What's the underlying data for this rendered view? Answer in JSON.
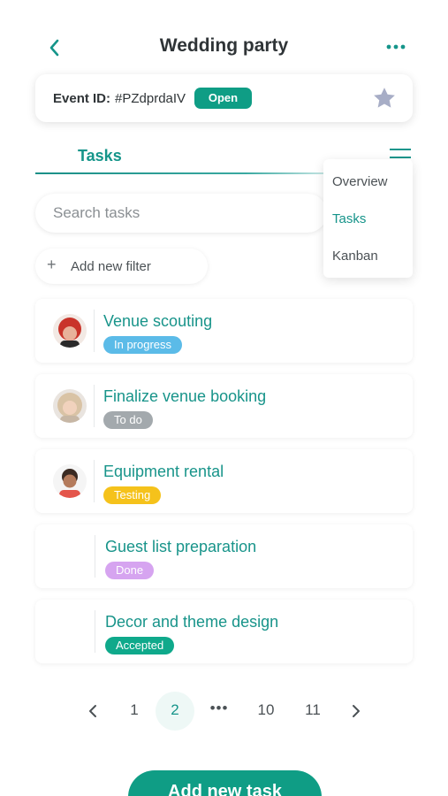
{
  "header": {
    "title": "Wedding party",
    "back_icon": "chevron-left-icon",
    "more_icon": "more-horizontal-icon"
  },
  "event": {
    "id_label": "Event ID:",
    "id_value": "#PZdprdaIV",
    "status": "Open",
    "star_icon": "star-icon"
  },
  "tabs": {
    "active": "Tasks",
    "menu_icon": "menu-icon"
  },
  "view_menu": {
    "items": [
      "Overview",
      "Tasks",
      "Kanban"
    ],
    "selected": "Tasks"
  },
  "search": {
    "placeholder": "Search tasks",
    "value": ""
  },
  "filter": {
    "label": "Add new filter",
    "icon": "plus-icon"
  },
  "tasks": [
    {
      "name": "Venue scouting",
      "status": "In progress",
      "status_color": "#5bbbe8",
      "avatar": "red-hair-person"
    },
    {
      "name": "Finalize venue booking",
      "status": "To do",
      "status_color": "#a3a9ad",
      "avatar": "blonde-woman"
    },
    {
      "name": "Equipment rental",
      "status": "Testing",
      "status_color": "#f5c21b",
      "avatar": "bearded-man"
    },
    {
      "name": "Guest list preparation",
      "status": "Done",
      "status_color": "#d6a4f0",
      "avatar": ""
    },
    {
      "name": "Decor and theme design",
      "status": "Accepted",
      "status_color": "#0fa98b",
      "avatar": ""
    }
  ],
  "pagination": {
    "pages": [
      "1",
      "2",
      "10",
      "11"
    ],
    "ellipsis": "•••",
    "current": "2"
  },
  "cta": {
    "label": "Add new task"
  },
  "colors": {
    "accent": "#0f9d85",
    "link": "#18948a"
  }
}
